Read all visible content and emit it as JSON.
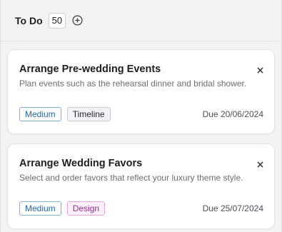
{
  "column": {
    "title": "To Do",
    "count": "50"
  },
  "cards": [
    {
      "title": "Arrange Pre-wedding Events",
      "description": "Plan events such as the rehearsal dinner and bridal shower.",
      "tags": [
        "Medium",
        "Timeline"
      ],
      "due": "Due 20/06/2024"
    },
    {
      "title": "Arrange Wedding Favors",
      "description": "Select and order favors that reflect your luxury theme style.",
      "tags": [
        "Medium",
        "Design"
      ],
      "due": "Due 25/07/2024"
    }
  ],
  "icons": {
    "add": "plus-circle-icon",
    "close": "close-icon"
  },
  "colors": {
    "medium_tag": "#2867a8",
    "timeline_tag": "#25272c",
    "design_tag": "#a02a98"
  }
}
